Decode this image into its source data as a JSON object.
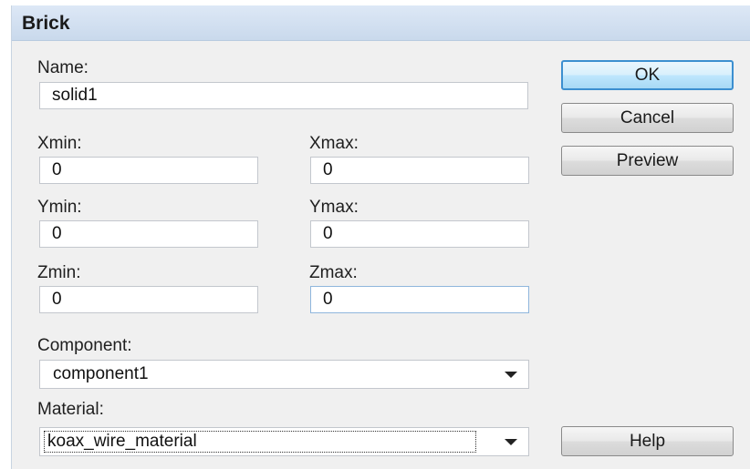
{
  "window": {
    "title": "Brick"
  },
  "form": {
    "name_label": "Name:",
    "name_value": "solid1",
    "xmin_label": "Xmin:",
    "xmin_value": "0",
    "xmax_label": "Xmax:",
    "xmax_value": "0",
    "ymin_label": "Ymin:",
    "ymin_value": "0",
    "ymax_label": "Ymax:",
    "ymax_value": "0",
    "zmin_label": "Zmin:",
    "zmin_value": "0",
    "zmax_label": "Zmax:",
    "zmax_value": "0",
    "component_label": "Component:",
    "component_value": "component1",
    "material_label": "Material:",
    "material_value": "koax_wire_material"
  },
  "buttons": {
    "ok": "OK",
    "cancel": "Cancel",
    "preview": "Preview",
    "help": "Help"
  },
  "icons": {
    "dropdown": "chevron-down-icon"
  }
}
